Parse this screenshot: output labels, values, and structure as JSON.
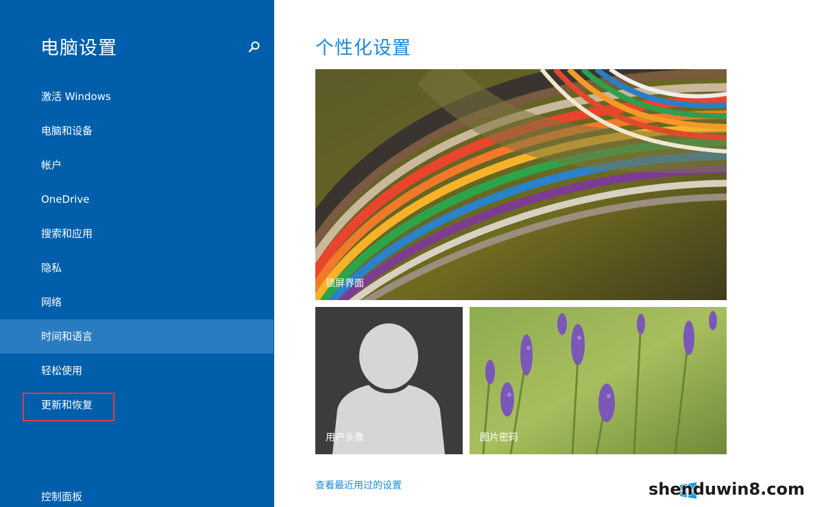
{
  "sidebar": {
    "title": "电脑设置",
    "items": [
      {
        "label": "激活 Windows"
      },
      {
        "label": "电脑和设备"
      },
      {
        "label": "帐户"
      },
      {
        "label": "OneDrive"
      },
      {
        "label": "搜索和应用"
      },
      {
        "label": "隐私"
      },
      {
        "label": "网络"
      },
      {
        "label": "时间和语言",
        "selected": true
      },
      {
        "label": "轻松使用"
      },
      {
        "label": "更新和恢复",
        "highlighted": true
      }
    ],
    "footer": "控制面板"
  },
  "main": {
    "title": "个性化设置",
    "tiles": {
      "lock_screen": "锁屏界面",
      "account_picture": "用户头像",
      "picture_password": "图片密码"
    },
    "recent_link": "查看最近用过的设置"
  },
  "watermark": "shenduwin8.com",
  "colors": {
    "sidebar_bg": "#005eab",
    "selected_bg": "#2a7cc0",
    "accent": "#1b8ad8",
    "highlight_border": "#e03c3c"
  },
  "icons": {
    "search": "search-icon",
    "avatar": "person-silhouette-icon",
    "watermark_logo": "windows-logo-icon"
  }
}
